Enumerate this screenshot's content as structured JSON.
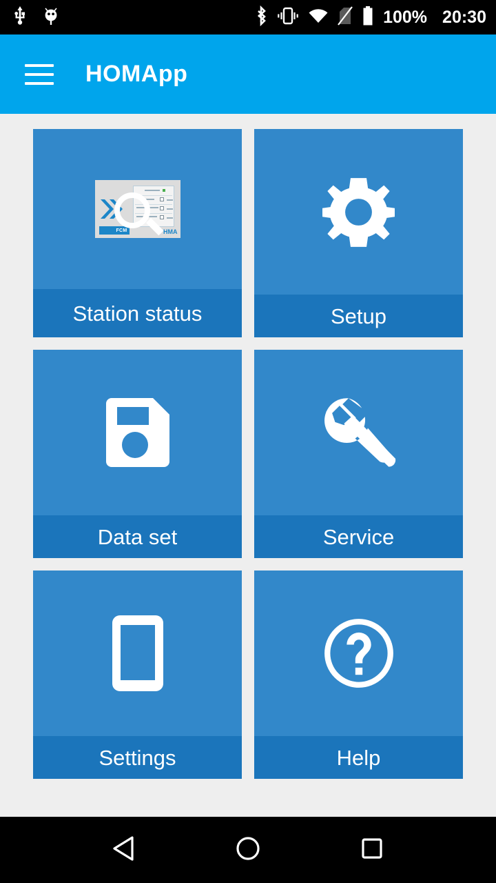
{
  "status_bar": {
    "left_icons": [
      {
        "name": "usb-icon",
        "label": "USB"
      },
      {
        "name": "android-debug-icon",
        "label": "Android debug"
      }
    ],
    "right_icons": [
      {
        "name": "bluetooth-icon",
        "label": "Bluetooth"
      },
      {
        "name": "vibrate-icon",
        "label": "Vibrate"
      },
      {
        "name": "wifi-icon",
        "label": "Wi-Fi"
      },
      {
        "name": "no-sim-icon",
        "label": "No SIM"
      },
      {
        "name": "battery-icon",
        "label": "Battery"
      }
    ],
    "battery_percent": "100%",
    "clock": "20:30",
    "background_color": "#000000",
    "foreground_color": "#ffffff"
  },
  "app_bar": {
    "menu_icon": "hamburger-menu-icon",
    "title": "HOMApp",
    "background_color": "#00a5ec",
    "title_color": "#ffffff"
  },
  "theme": {
    "page_background": "#eeeeee",
    "tile_body": "#3288ca",
    "tile_label_strip": "#1b75bb",
    "tile_label_text": "#ffffff"
  },
  "grid": {
    "tiles": [
      {
        "id": "station-status",
        "label": "Station status",
        "icon": "station-status-thumbnail-icon"
      },
      {
        "id": "setup",
        "label": "Setup",
        "icon": "gear-icon"
      },
      {
        "id": "data-set",
        "label": "Data set",
        "icon": "floppy-disk-icon"
      },
      {
        "id": "service",
        "label": "Service",
        "icon": "wrench-icon"
      },
      {
        "id": "settings",
        "label": "Settings",
        "icon": "smartphone-icon"
      },
      {
        "id": "help",
        "label": "Help",
        "icon": "question-mark-circle-icon"
      }
    ]
  },
  "thumbnail": {
    "badge": "FCM",
    "brand": "HMA"
  },
  "nav_bar": {
    "buttons": [
      {
        "name": "back-button",
        "icon": "triangle-back-icon"
      },
      {
        "name": "home-button",
        "icon": "circle-home-icon"
      },
      {
        "name": "recents-button",
        "icon": "square-recents-icon"
      }
    ],
    "background_color": "#000000"
  }
}
